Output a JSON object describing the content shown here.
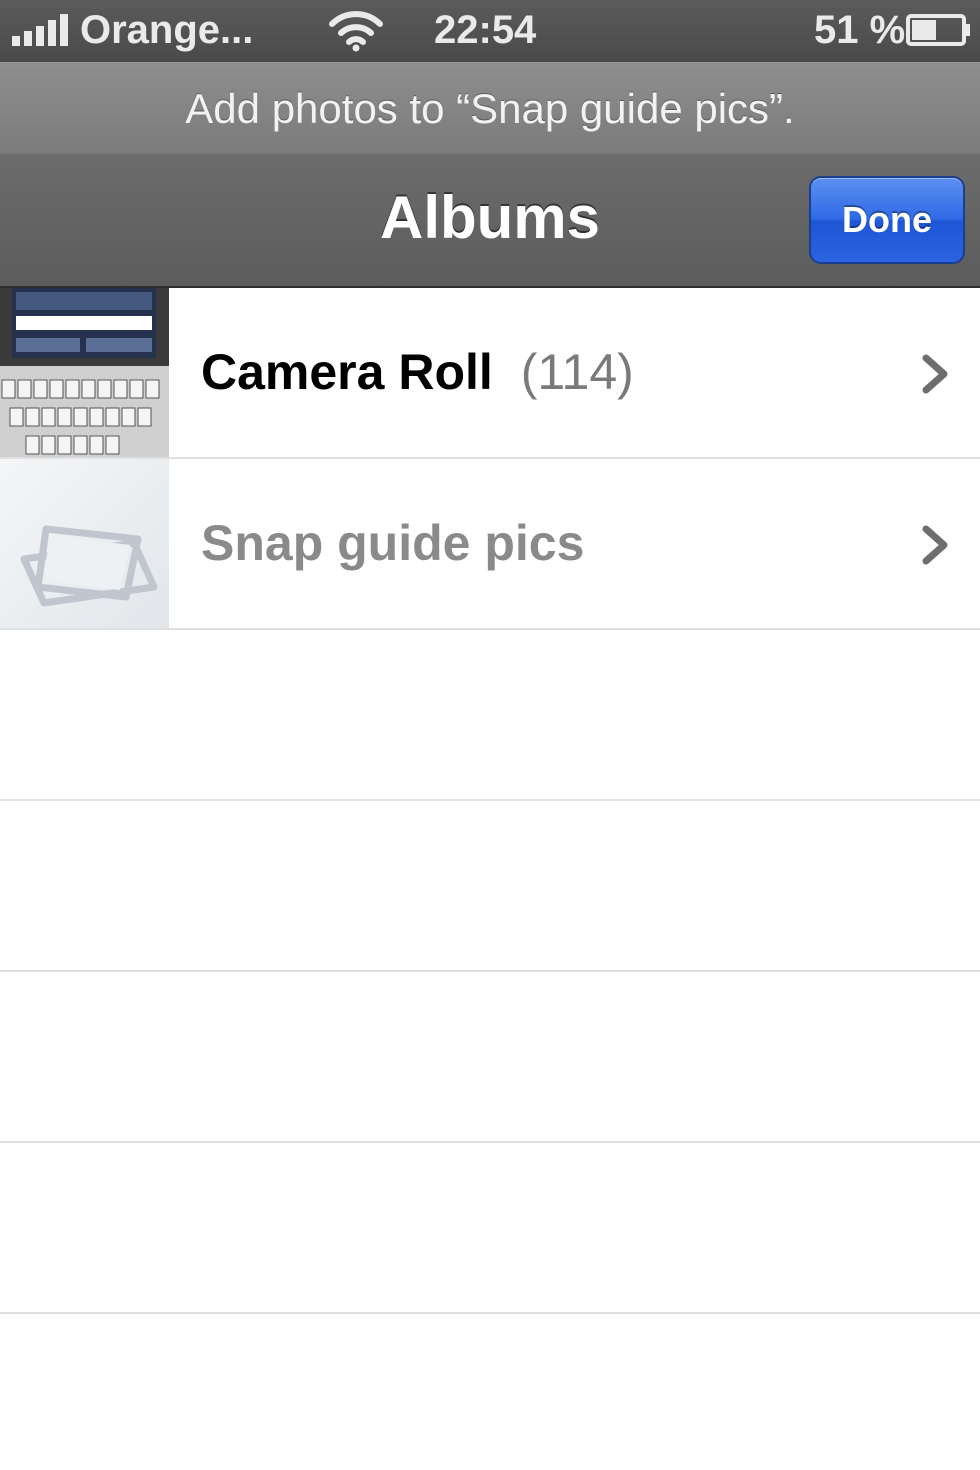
{
  "status_bar": {
    "carrier": "Orange...",
    "time": "22:54",
    "battery_percent": "51 %",
    "battery_level": 0.51,
    "icons": [
      "signal-bars-icon",
      "wifi-icon",
      "battery-icon"
    ]
  },
  "prompt": {
    "text": "Add photos to “Snap guide pics”."
  },
  "nav": {
    "title": "Albums",
    "done_label": "Done"
  },
  "albums": [
    {
      "name": "Camera Roll",
      "count": "(114)",
      "thumbnail": "keyboard-screenshot"
    },
    {
      "name": "Snap guide pics",
      "count": "",
      "thumbnail": "empty-album-icon"
    }
  ],
  "colors": {
    "done_button": "#2f6be6",
    "nav_bar": "#636363",
    "status_bar": "#505050",
    "separator": "#e0e0e0",
    "dim_text": "#8a8a8a"
  }
}
